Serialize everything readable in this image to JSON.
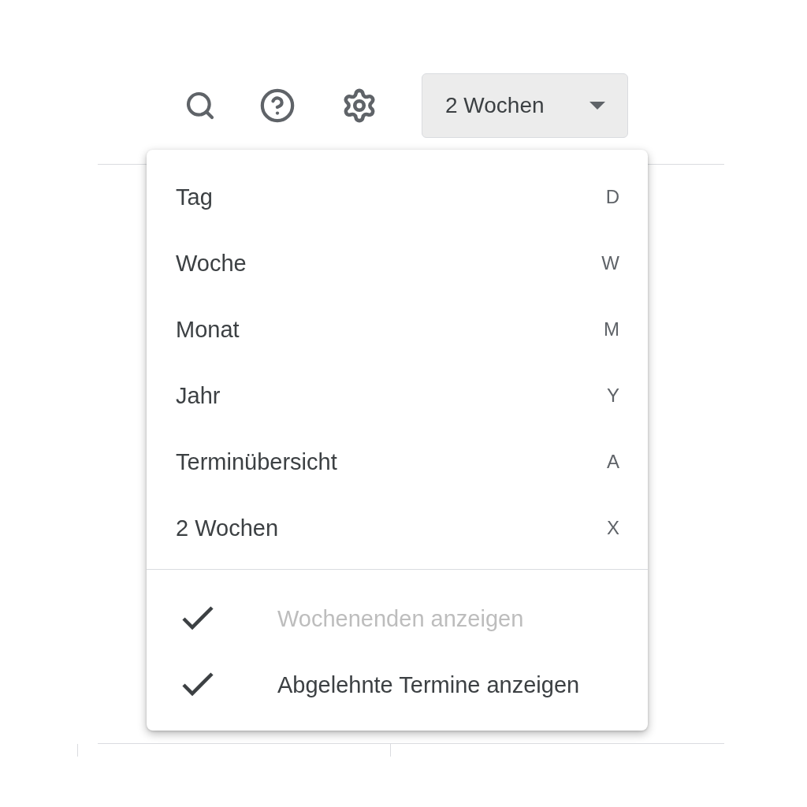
{
  "toolbar": {
    "view_button": {
      "label": "2 Wochen",
      "expanded": true
    }
  },
  "menu": {
    "views": [
      {
        "label": "Tag",
        "shortcut": "D"
      },
      {
        "label": "Woche",
        "shortcut": "W"
      },
      {
        "label": "Monat",
        "shortcut": "M"
      },
      {
        "label": "Jahr",
        "shortcut": "Y"
      },
      {
        "label": "Terminübersicht",
        "shortcut": "A"
      },
      {
        "label": "2 Wochen",
        "shortcut": "X"
      }
    ],
    "options": [
      {
        "label": "Wochenenden anzeigen",
        "checked": true,
        "disabled": true
      },
      {
        "label": "Abgelehnte Termine anzeigen",
        "checked": true,
        "disabled": false
      }
    ]
  }
}
